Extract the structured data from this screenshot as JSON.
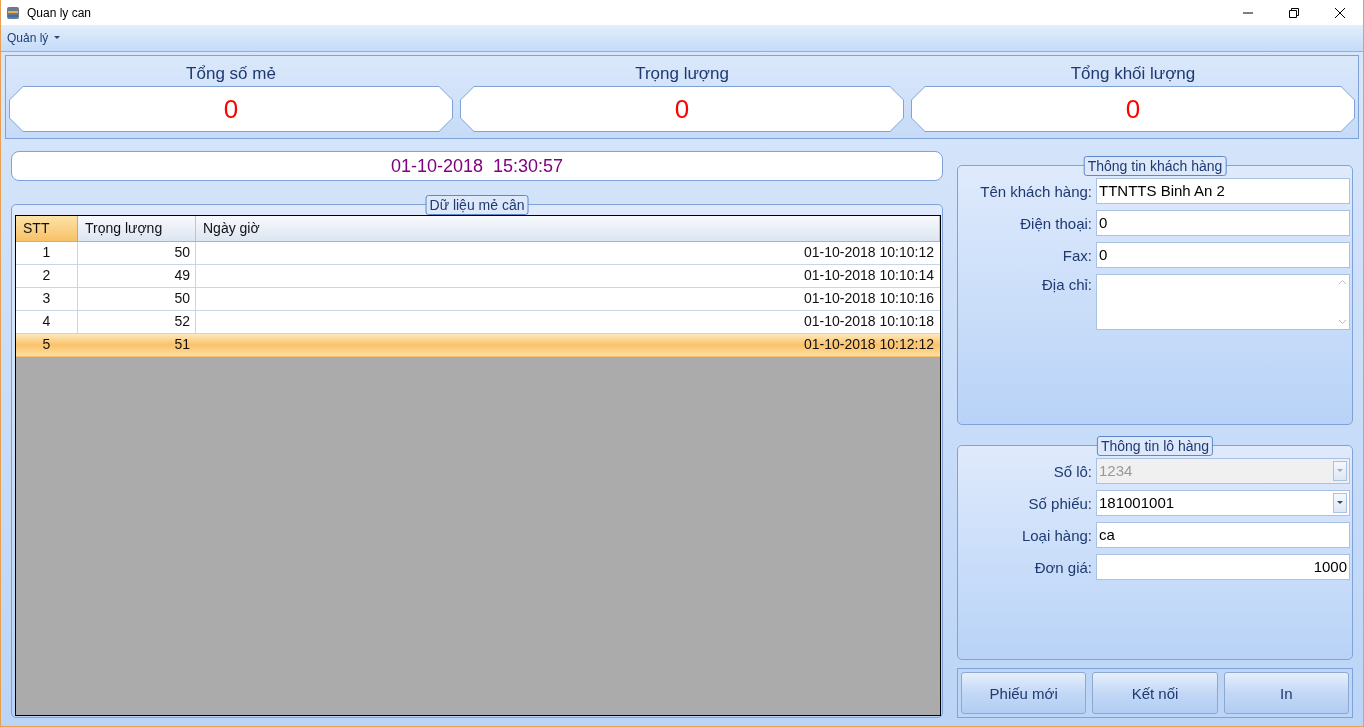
{
  "window": {
    "title": "Quan ly can"
  },
  "menu": [
    {
      "label": "Quản lý"
    }
  ],
  "summary": [
    {
      "label": "Tổng số mẻ",
      "value": "0"
    },
    {
      "label": "Trọng lượng",
      "value": "0"
    },
    {
      "label": "Tổng khối lượng",
      "value": "0"
    }
  ],
  "clock": "01-10-2018  15:30:57",
  "weighings": {
    "title": "Dữ liệu mẻ cân",
    "columns": [
      "STT",
      "Trọng lượng",
      "Ngày giờ"
    ],
    "rows": [
      {
        "cells": [
          "1",
          "50",
          "01-10-2018 10:10:12"
        ],
        "selected": false
      },
      {
        "cells": [
          "2",
          "49",
          "01-10-2018 10:10:14"
        ],
        "selected": false
      },
      {
        "cells": [
          "3",
          "50",
          "01-10-2018 10:10:16"
        ],
        "selected": false
      },
      {
        "cells": [
          "4",
          "52",
          "01-10-2018 10:10:18"
        ],
        "selected": false
      },
      {
        "cells": [
          "5",
          "51",
          "01-10-2018 10:12:12"
        ],
        "selected": true
      }
    ]
  },
  "customer": {
    "title": "Thông tin khách hàng",
    "fields": [
      {
        "label": "Tên khách hàng:",
        "value": "TTNTTS Binh An 2",
        "kind": "text"
      },
      {
        "label": "Điện thoại:",
        "value": "0",
        "kind": "text"
      },
      {
        "label": "Fax:",
        "value": "0",
        "kind": "text"
      },
      {
        "label": "Địa chỉ:",
        "kind": "textarea"
      }
    ]
  },
  "lot": {
    "title": "Thông tin lô hàng",
    "fields": [
      {
        "label": "Số lô:",
        "value": "1234",
        "kind": "combo",
        "disabled": true
      },
      {
        "label": "Số phiếu:",
        "value": "181001001",
        "kind": "combo",
        "disabled": false
      },
      {
        "label": "Loại hàng:",
        "value": "ca",
        "kind": "text"
      },
      {
        "label": "Đơn giá:",
        "value": "1000",
        "kind": "number"
      }
    ]
  },
  "buttons": [
    "Phiếu mới",
    "Kết nối",
    "In"
  ]
}
